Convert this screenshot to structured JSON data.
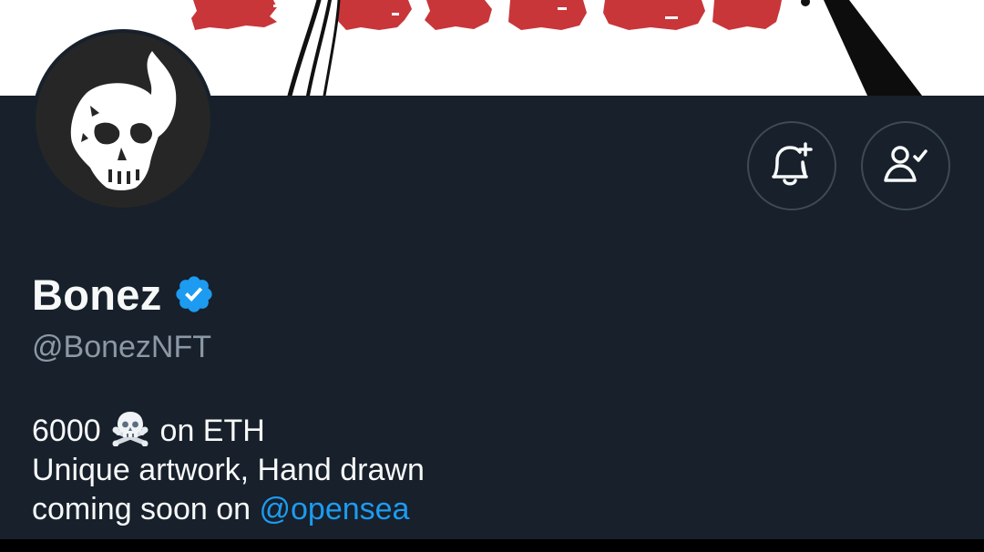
{
  "profile": {
    "display_name": "Bonez",
    "handle": "@BonezNFT",
    "verified": true,
    "avatar_icon": "skull-logo-icon",
    "banner_icon": "bonez-banner-art"
  },
  "actions": {
    "notify_icon": "bell-plus-icon",
    "following_icon": "person-check-icon"
  },
  "bio": {
    "line1_count": "6000",
    "line1_icon": "skull-crossbones-icon",
    "line1_rest": " on ETH",
    "line2": "Unique artwork, Hand drawn",
    "line3_prefix": "coming soon on ",
    "line3_mention": "@opensea"
  },
  "colors": {
    "background": "#17202b",
    "name": "#f7f9f9",
    "handle": "#8b98a5",
    "link": "#1d9bf0",
    "verified_badge": "#1d9bf0",
    "banner_red": "#c8363a"
  }
}
